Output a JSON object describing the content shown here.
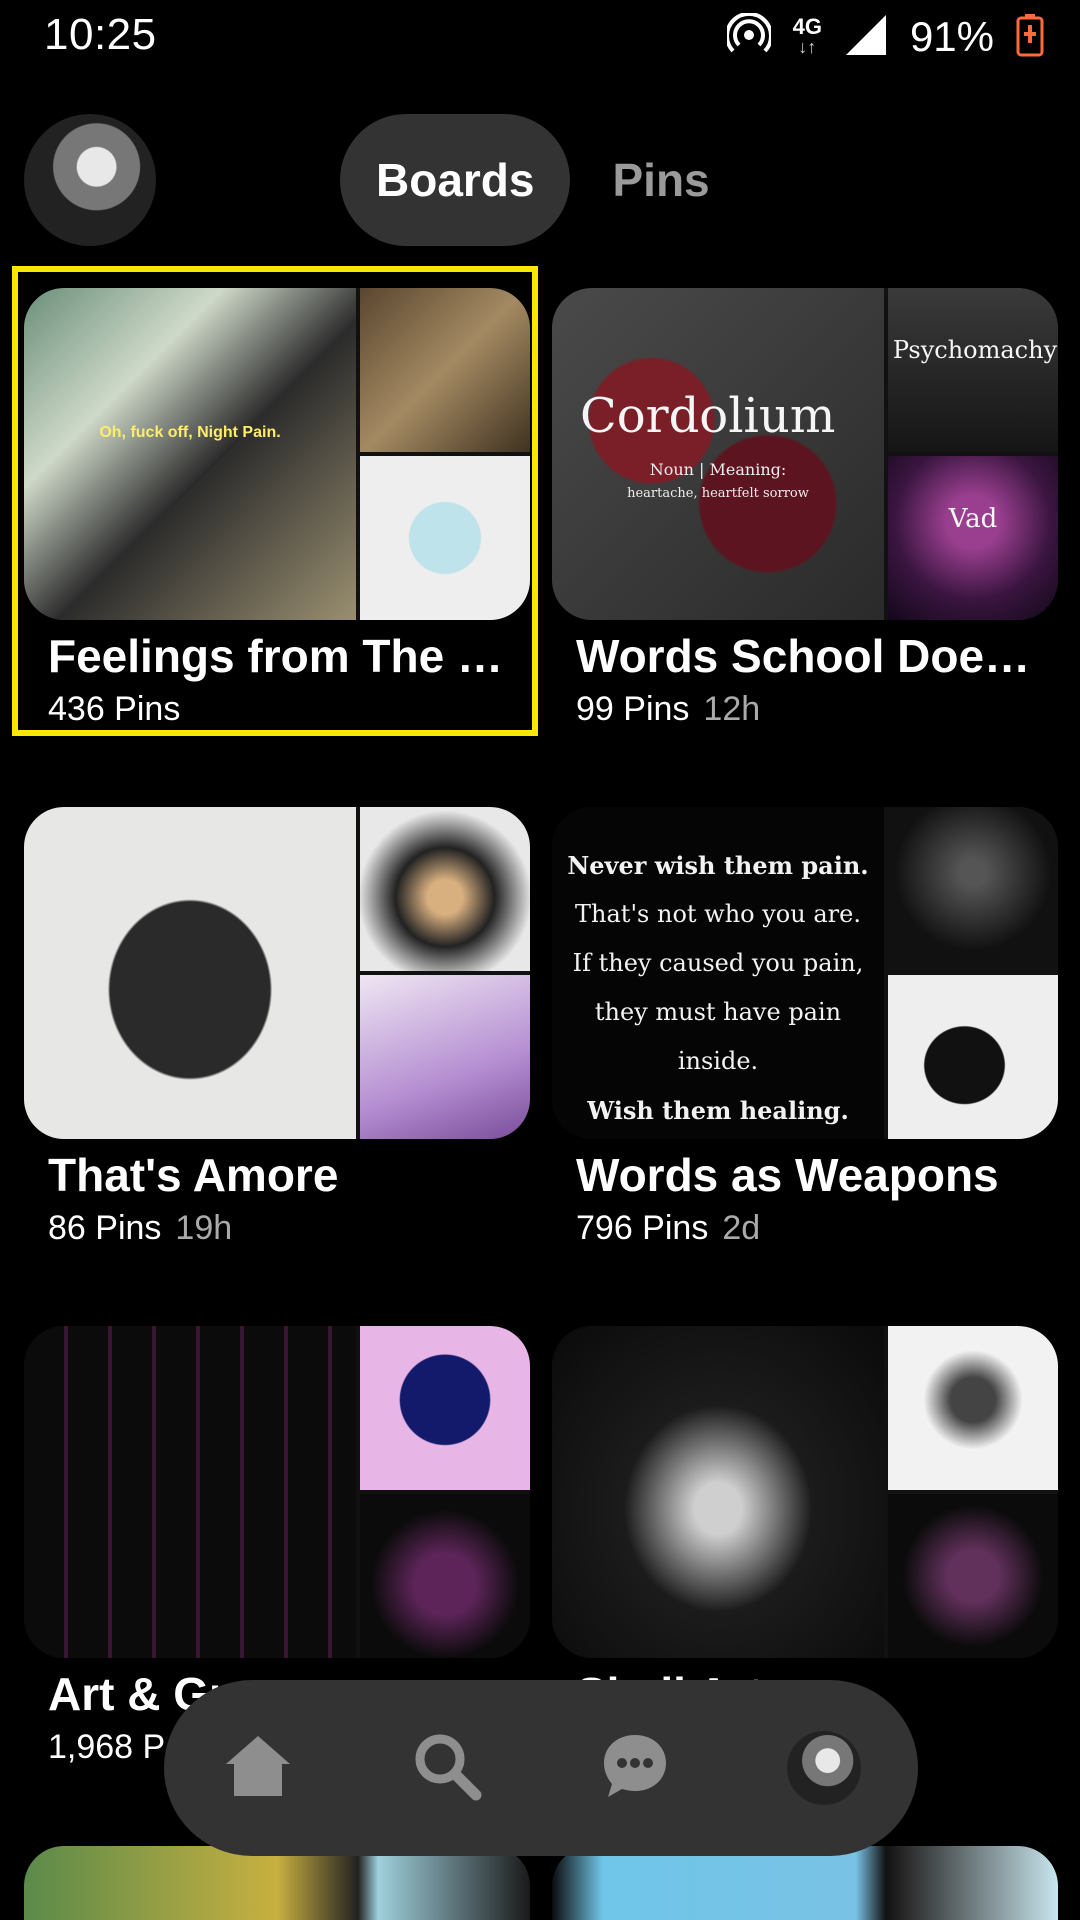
{
  "status_bar": {
    "time": "10:25",
    "network_type": "4G",
    "battery_percent": "91%"
  },
  "header": {
    "tabs": [
      {
        "label": "Boards",
        "active": true
      },
      {
        "label": "Pins",
        "active": false
      }
    ]
  },
  "boards": [
    {
      "title": "Feelings from The …",
      "pin_count": "436 Pins",
      "updated": "",
      "selected": true,
      "cover_caption": "Oh, fuck off, Night Pain."
    },
    {
      "title": "Words School Does…",
      "pin_count": "99 Pins",
      "updated": "12h",
      "cover_text": {
        "main": "Cordolium",
        "sub1": "Noun | Meaning:",
        "sub2": "heartache, heartfelt sorrow",
        "small1": "Psychomachy",
        "small2": "Vad"
      }
    },
    {
      "title": "That's Amore",
      "pin_count": "86 Pins",
      "updated": "19h"
    },
    {
      "title": "Words as Weapons",
      "pin_count": "796 Pins",
      "updated": "2d",
      "cover_quote": [
        "Never wish them pain.",
        "That's not who you are.",
        "If they caused you pain,",
        "they must have pain inside.",
        "Wish them healing."
      ]
    },
    {
      "title": "Art & Gr",
      "pin_count": "1,968 P",
      "updated": ""
    },
    {
      "title": "Skull Art",
      "pin_count": "",
      "updated": ""
    }
  ],
  "bottom_nav": {
    "items": [
      "home-icon",
      "search-icon",
      "messages-icon",
      "profile-avatar"
    ]
  },
  "colors": {
    "background": "#000000",
    "pill": "#333333",
    "selection": "#ffe600",
    "muted_text": "#9a9a9a"
  }
}
